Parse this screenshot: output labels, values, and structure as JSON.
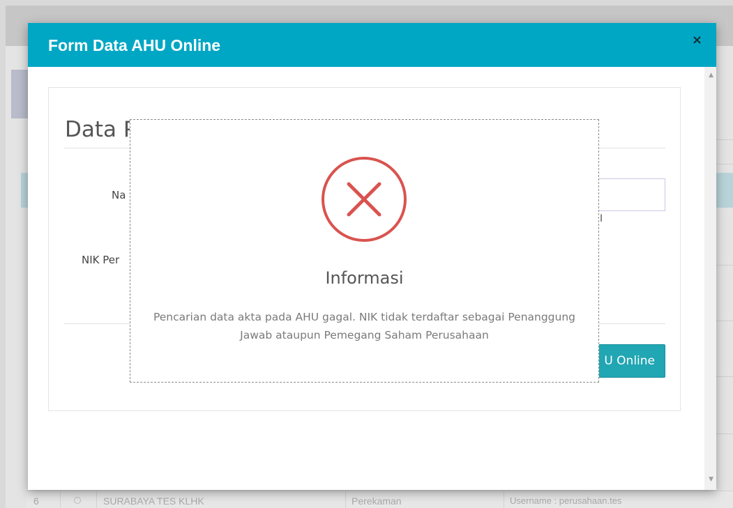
{
  "background": {
    "table_row": {
      "number": "6",
      "name": "SURABAYA TES KLHK",
      "status": "Perekaman",
      "account": "Username : perusahaan.tes"
    }
  },
  "modal": {
    "title": "Form Data AHU Online",
    "close_glyph": "×",
    "header_color": "#00a7c4",
    "panel": {
      "title": "Data P",
      "label_nama": "Na",
      "label_nik": "NIK Per",
      "field_hint": "I",
      "search_button": "U Online"
    }
  },
  "dialog": {
    "icon": "error-x-circle-icon",
    "icon_color": "#d9534f",
    "title": "Informasi",
    "message": "Pencarian data akta pada AHU gagal. NIK tidak terdaftar sebagai Penanggung Jawab ataupun Pemegang Saham Perusahaan"
  }
}
